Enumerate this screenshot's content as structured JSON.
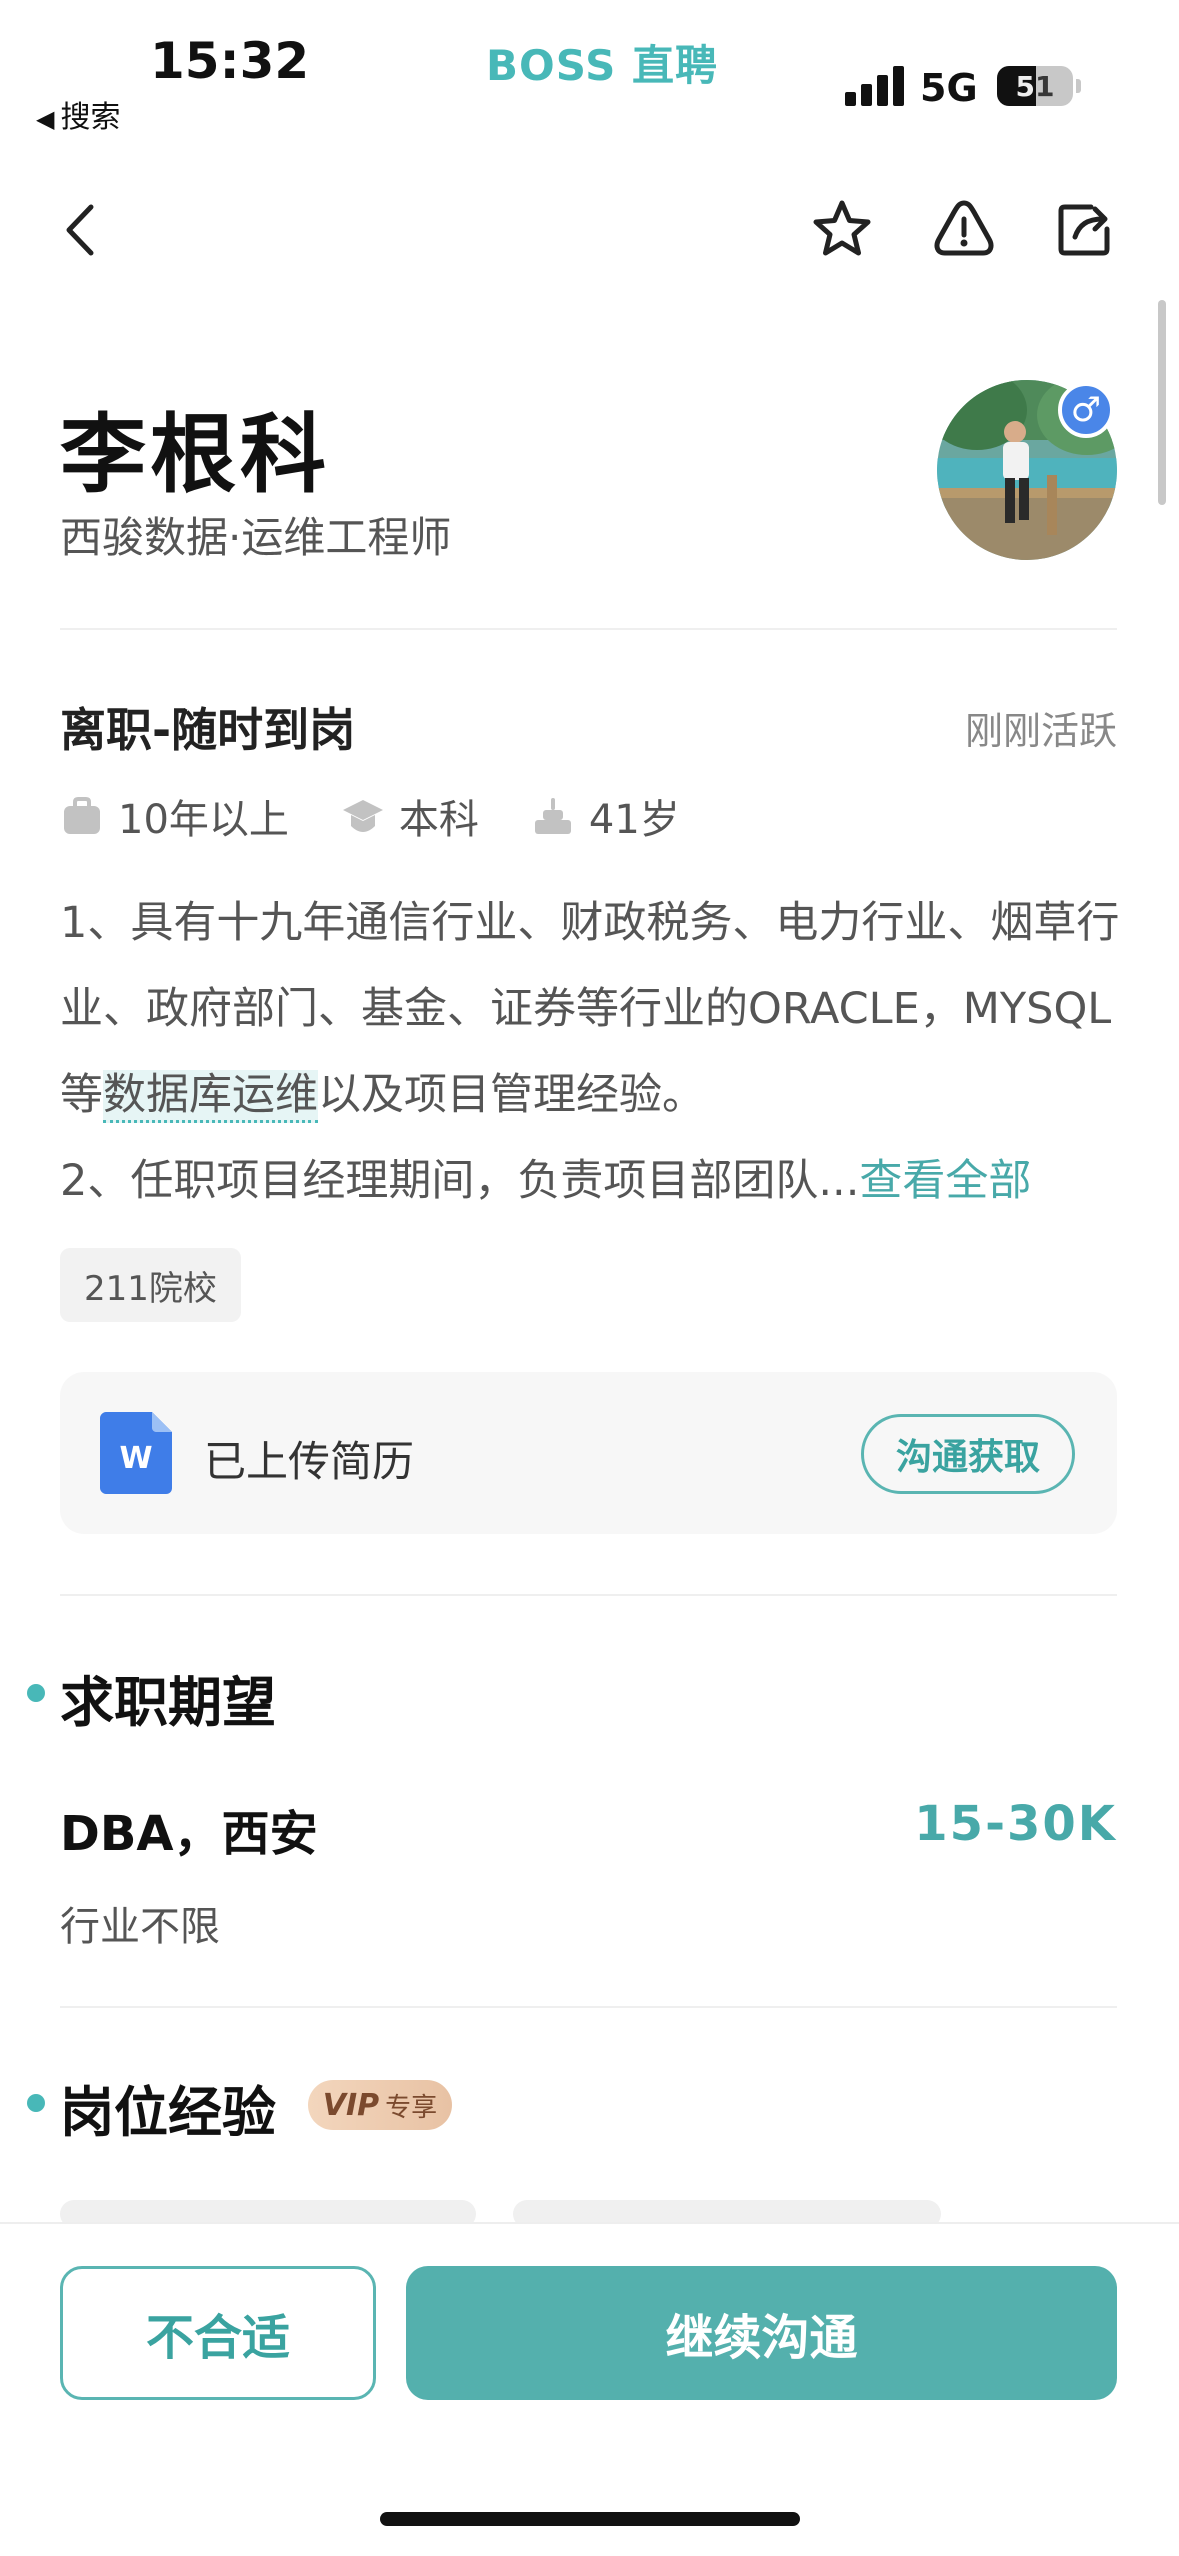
{
  "status_bar": {
    "time": "15:32",
    "back_app": "搜索",
    "brand": "BOSS 直聘",
    "network": "5G",
    "battery": "51"
  },
  "nav": {
    "icons": [
      "back-icon",
      "star-icon",
      "warning-icon",
      "share-icon"
    ]
  },
  "profile": {
    "name": "李根科",
    "company_title": "西骏数据·运维工程师",
    "gender": "♂"
  },
  "status": {
    "job_status": "离职-随时到岗",
    "active": "刚刚活跃",
    "experience": "10年以上",
    "education": "本科",
    "age": "41岁"
  },
  "summary": {
    "part1": "1、具有十九年通信行业、财政税务、电力行业、烟草行业、政府部门、基金、证券等行业的ORACLE，MYSQL等",
    "highlight": "数据库运维",
    "part2": "以及项目管理经验。",
    "part3": "2、任职项目经理期间，负责项目部团队...",
    "view_all": "查看全部"
  },
  "tags": [
    "211院校"
  ],
  "resume": {
    "label": "已上传简历",
    "action": "沟通获取"
  },
  "expectation": {
    "section_title": "求职期望",
    "position": "DBA，西安",
    "salary": "15-30K",
    "industry": "行业不限"
  },
  "experience_section": {
    "title": "岗位经验",
    "vip_label": "VIP",
    "vip_text": "专享"
  },
  "actions": {
    "reject": "不合适",
    "continue": "继续沟通"
  },
  "colors": {
    "accent": "#54b0ad",
    "brand": "#48b8b8",
    "gender_badge": "#4a86e8"
  }
}
